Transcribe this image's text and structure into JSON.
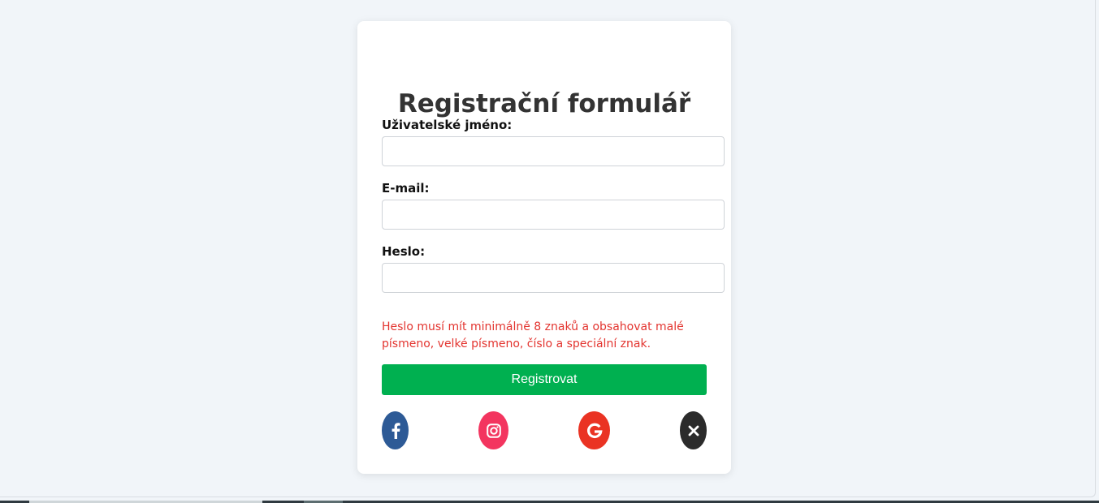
{
  "form": {
    "title": "Registrační formulář",
    "username_label": "Uživatelské jméno:",
    "username_value": "",
    "email_label": "E-mail:",
    "email_value": "",
    "password_label": "Heslo:",
    "password_value": "",
    "password_error": "Heslo musí mít minimálně 8 znaků a obsahovat malé písmeno, velké písmeno, číslo a speciální znak.",
    "submit_label": "Registrovat"
  },
  "social": [
    {
      "icon": "facebook-icon",
      "color": "#2d5a96"
    },
    {
      "icon": "instagram-icon",
      "color": "#f3355f"
    },
    {
      "icon": "google-icon",
      "color": "#ea3323"
    },
    {
      "icon": "x-icon",
      "color": "#2b2b2b"
    }
  ],
  "colors": {
    "background": "#f1f5f9",
    "card": "#ffffff",
    "accent": "#00b050",
    "error": "#e3342f"
  }
}
